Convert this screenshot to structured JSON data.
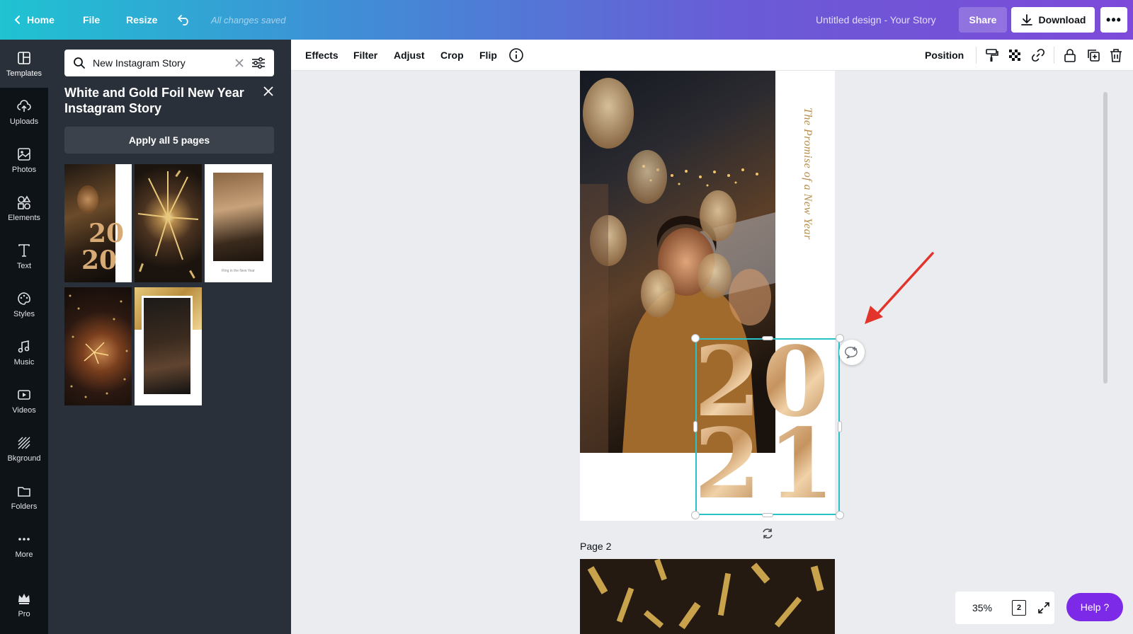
{
  "topbar": {
    "home": "Home",
    "file": "File",
    "resize": "Resize",
    "saved_status": "All changes saved",
    "design_title": "Untitled design - Your Story",
    "share": "Share",
    "download": "Download",
    "more": "•••"
  },
  "rail": {
    "items": [
      {
        "label": "Templates",
        "icon": "templates-icon"
      },
      {
        "label": "Uploads",
        "icon": "upload-cloud-icon"
      },
      {
        "label": "Photos",
        "icon": "image-icon"
      },
      {
        "label": "Elements",
        "icon": "shapes-icon"
      },
      {
        "label": "Text",
        "icon": "text-icon"
      },
      {
        "label": "Styles",
        "icon": "palette-icon"
      },
      {
        "label": "Music",
        "icon": "music-note-icon"
      },
      {
        "label": "Videos",
        "icon": "video-icon"
      },
      {
        "label": "Bkground",
        "icon": "background-icon"
      },
      {
        "label": "Folders",
        "icon": "folder-icon"
      },
      {
        "label": "More",
        "icon": "more-dots-icon"
      },
      {
        "label": "Pro",
        "icon": "crown-icon"
      }
    ]
  },
  "panel": {
    "search_value": "New Instagram Story",
    "title": "White and Gold Foil New Year Instagram Story",
    "apply_button": "Apply all 5 pages",
    "thumb_year_top": "20",
    "thumb_year_bottom": "20",
    "thumb_caption": "Ring in the New Year"
  },
  "toolbar": {
    "effects": "Effects",
    "filter": "Filter",
    "adjust": "Adjust",
    "crop": "Crop",
    "flip": "Flip",
    "position": "Position"
  },
  "canvas": {
    "vertical_text": "The Promise of a New Year",
    "year_digits": [
      "2",
      "0",
      "2",
      "1"
    ],
    "page2_label": "Page 2"
  },
  "bottom": {
    "zoom": "35%",
    "page_count": "2",
    "help": "Help ?"
  },
  "colors": {
    "accent_purple": "#7d2ae8",
    "selection": "#28c3c9",
    "gold": "#d7aa76",
    "dark_panel": "#293039",
    "rail": "#0e1318"
  }
}
